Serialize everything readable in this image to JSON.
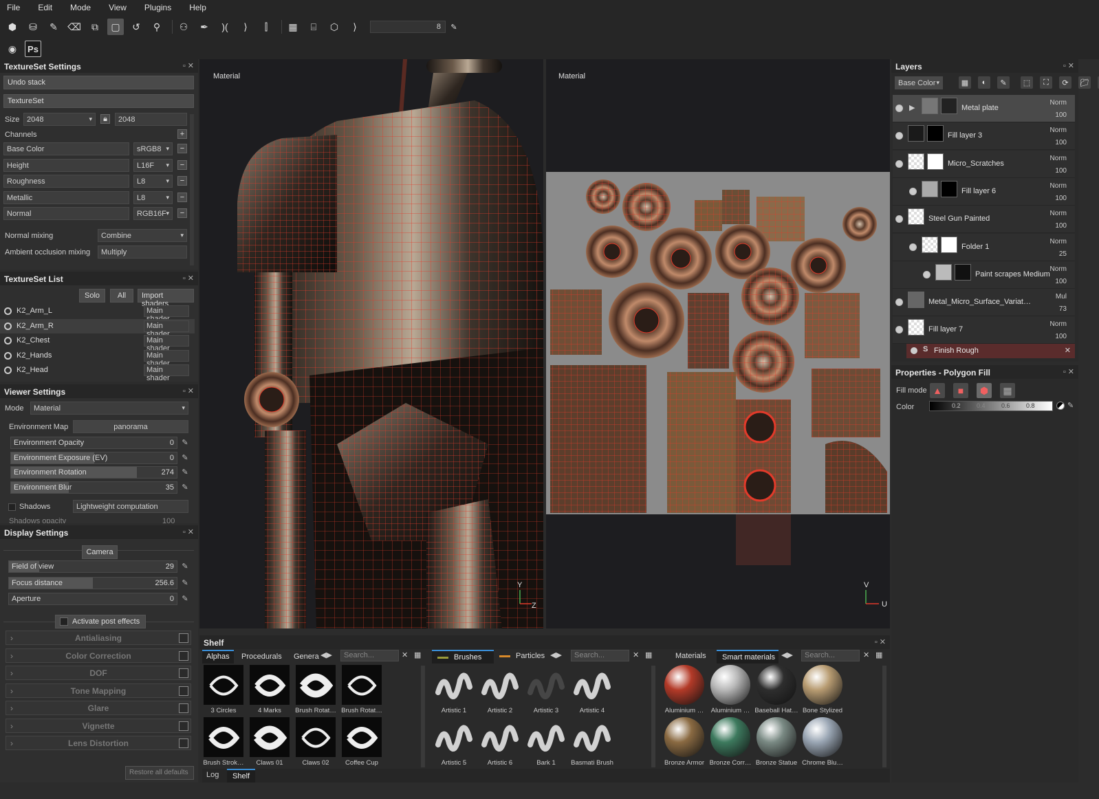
{
  "menu": [
    "File",
    "Edit",
    "Mode",
    "View",
    "Plugins",
    "Help"
  ],
  "toolbar": {
    "brush_size": "8",
    "ps_label": "Ps"
  },
  "textureset_settings": {
    "title": "TextureSet Settings",
    "undo_stack": "Undo stack",
    "textureset": "TextureSet",
    "size_label": "Size",
    "size_value": "2048",
    "size_value2": "2048",
    "channels_label": "Channels",
    "channels": [
      {
        "name": "Base Color",
        "format": "sRGB8"
      },
      {
        "name": "Height",
        "format": "L16F"
      },
      {
        "name": "Roughness",
        "format": "L8"
      },
      {
        "name": "Metallic",
        "format": "L8"
      },
      {
        "name": "Normal",
        "format": "RGB16F"
      }
    ],
    "normal_mixing_label": "Normal mixing",
    "normal_mixing_value": "Combine",
    "ao_mixing_label": "Ambient occlusion mixing",
    "ao_mixing_value": "Multiply"
  },
  "textureset_list": {
    "title": "TextureSet List",
    "solo": "Solo",
    "all": "All",
    "import": "Import shaders",
    "items": [
      {
        "name": "K2_Arm_L",
        "shader": "Main shader"
      },
      {
        "name": "K2_Arm_R",
        "shader": "Main shader"
      },
      {
        "name": "K2_Chest",
        "shader": "Main shader"
      },
      {
        "name": "K2_Hands",
        "shader": "Main shader"
      },
      {
        "name": "K2_Head",
        "shader": "Main shader"
      }
    ]
  },
  "viewer_settings": {
    "title": "Viewer Settings",
    "mode_label": "Mode",
    "mode_value": "Material",
    "env_map_label": "Environment Map",
    "env_map_value": "panorama",
    "sliders": [
      {
        "label": "Environment Opacity",
        "value": "0",
        "fill": 0
      },
      {
        "label": "Environment Exposure (EV)",
        "value": "0",
        "fill": 0.5
      },
      {
        "label": "Environment Rotation",
        "value": "274",
        "fill": 0.76
      },
      {
        "label": "Environment Blur",
        "value": "35",
        "fill": 0.35
      }
    ],
    "shadows_label": "Shadows",
    "shadows_value": "Lightweight computation",
    "shadows_opacity_label": "Shadows opacity",
    "shadows_opacity_value": "100"
  },
  "display_settings": {
    "title": "Display Settings",
    "camera": "Camera",
    "sliders": [
      {
        "label": "Field of view",
        "value": "29",
        "fill": 0.18
      },
      {
        "label": "Focus distance",
        "value": "256.6",
        "fill": 0.5
      },
      {
        "label": "Aperture",
        "value": "0",
        "fill": 0
      }
    ],
    "post_effects": "Activate post effects",
    "effects": [
      "Antialiasing",
      "Color Correction",
      "DOF",
      "Tone Mapping",
      "Glare",
      "Vignette",
      "Lens Distortion"
    ],
    "restore": "Restore all defaults"
  },
  "viewport": {
    "left_label": "Material",
    "right_label": "Material",
    "axis_v": "V",
    "axis_u": "U",
    "axis_y": "Y",
    "axis_z": "Z"
  },
  "layers": {
    "title": "Layers",
    "channel": "Base Color",
    "items": [
      {
        "name": "Metal plate",
        "blend": "Norm",
        "opacity": "100"
      },
      {
        "name": "Fill layer 3",
        "blend": "Norm",
        "opacity": "100"
      },
      {
        "name": "Micro_Scratches",
        "blend": "Norm",
        "opacity": "100"
      },
      {
        "name": "Fill layer 6",
        "blend": "Norm",
        "opacity": "100"
      },
      {
        "name": "Steel Gun Painted",
        "blend": "Norm",
        "opacity": "100"
      },
      {
        "name": "Folder 1",
        "blend": "Norm",
        "opacity": "25"
      },
      {
        "name": "Paint scrapes Medium",
        "blend": "Norm",
        "opacity": "100"
      },
      {
        "name": "Metal_Micro_Surface_Variat…",
        "blend": "Mul",
        "opacity": "73"
      },
      {
        "name": "Fill layer 7",
        "blend": "Norm",
        "opacity": "100"
      }
    ],
    "effect": "Finish Rough"
  },
  "properties": {
    "title": "Properties - Polygon Fill",
    "fill_mode": "Fill mode",
    "color": "Color",
    "ticks": [
      "0.2",
      "0.4",
      "0.6",
      "0.8"
    ]
  },
  "shelf": {
    "title": "Shelf",
    "tabs1": [
      "Alphas",
      "Procedurals",
      "Genera"
    ],
    "search": "Search...",
    "alphas": [
      "3 Circles",
      "4 Marks",
      "Brush Rotat…",
      "Brush Rotat…",
      "Brush Strok…",
      "Claws 01",
      "Claws 02",
      "Coffee Cup"
    ],
    "tabs2": [
      "Brushes",
      "Particles"
    ],
    "brushes": [
      "Artistic 1",
      "Artistic 2",
      "Artistic 3",
      "Artistic 4",
      "Artistic 5",
      "Artistic 6",
      "Bark 1",
      "Basmati Brush"
    ],
    "tabs3": [
      "Materials",
      "Smart materials"
    ],
    "materials": [
      "Aluminium …",
      "Aluminium …",
      "Baseball Hat…",
      "Bone Stylized",
      "Bronze Armor",
      "Bronze Corr…",
      "Bronze Statue",
      "Chrome Blu…"
    ],
    "bottom_tabs": [
      "Log",
      "Shelf"
    ]
  },
  "colors": {
    "wire": "#e23a2a",
    "accent": "#3a8fd8"
  }
}
